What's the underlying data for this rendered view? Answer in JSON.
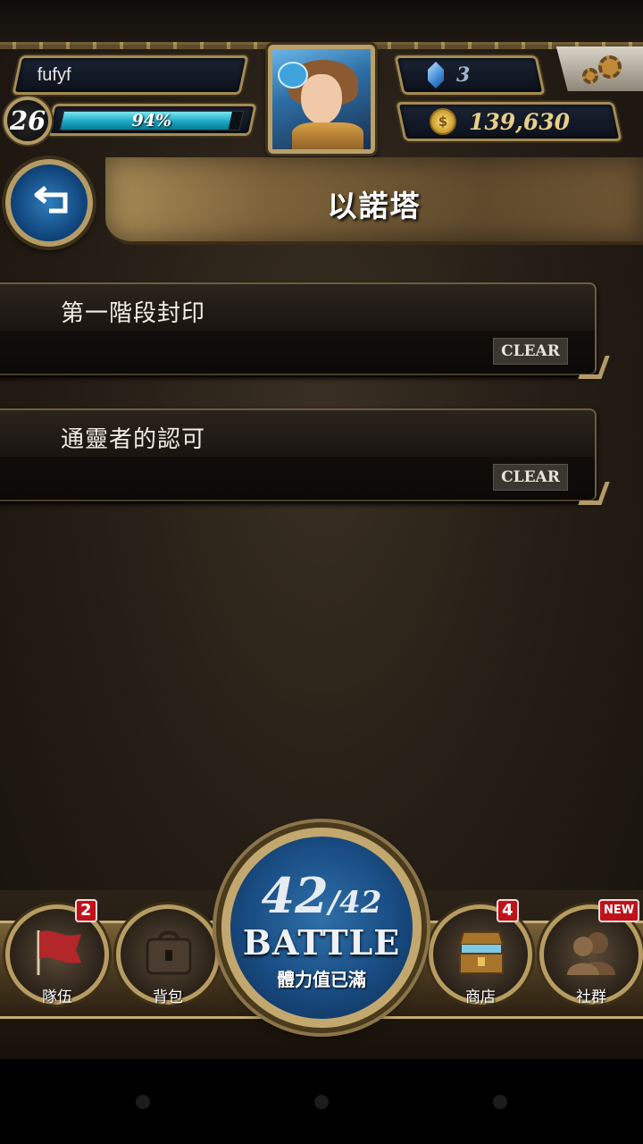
{
  "player": {
    "name": "fufyf",
    "level": "26",
    "exp_percent_text": "94%",
    "exp_fraction": 0.94,
    "gems": "3",
    "gold": "139,630",
    "coin_symbol": "$"
  },
  "page": {
    "title": "以諾塔"
  },
  "stages": [
    {
      "name": "第一階段封印",
      "status": "CLEAR"
    },
    {
      "name": "通靈者的認可",
      "status": "CLEAR"
    }
  ],
  "battle": {
    "current": "42",
    "max": "/42",
    "label": "BATTLE",
    "subtitle": "體力值已滿"
  },
  "nav": {
    "team": {
      "label": "隊伍",
      "badge": "2"
    },
    "bag": {
      "label": "背包"
    },
    "shop": {
      "label": "商店",
      "badge": "4"
    },
    "social": {
      "label": "社群",
      "badge": "NEW"
    }
  },
  "icons": {
    "back": "back-arrow-icon",
    "settings": "gears-icon",
    "gem": "gem-icon",
    "gold": "coin-icon",
    "team": "flag-icon",
    "bag": "bag-icon",
    "shop": "treasure-chest-icon",
    "social": "people-silhouette-icon"
  },
  "colors": {
    "exp_bar": "#1aa8c4",
    "badge_red": "#c0121a",
    "gold_text": "#e8cf88",
    "frame_gold": "#b59c66"
  }
}
